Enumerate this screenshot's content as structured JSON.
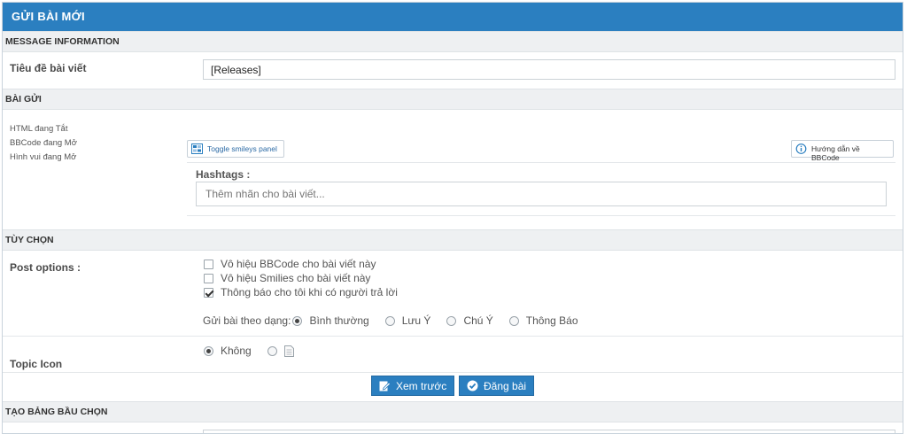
{
  "header": {
    "title": "GỬI BÀI MỚI"
  },
  "sections": {
    "message_info": "MESSAGE INFORMATION",
    "post": "BÀI GỬI",
    "options": "TÙY CHỌN",
    "poll": "TẠO BẢNG BẦU CHỌN"
  },
  "subject": {
    "label": "Tiêu đề bài viết",
    "value": "[Releases]"
  },
  "status": {
    "html": "HTML đang Tắt",
    "bbcode": "BBCode đang Mở",
    "smilies": "Hình vui đang Mở"
  },
  "editor": {
    "toggle_smileys": "Toggle smileys panel",
    "bbcode_help": "Hướng dẫn về BBCode"
  },
  "hashtags": {
    "label": "Hashtags :",
    "placeholder": "Thêm nhãn cho bài viết..."
  },
  "post_options": {
    "label": "Post options :",
    "checks": [
      {
        "text": "Vô hiệu BBCode cho bài viết này",
        "checked": false
      },
      {
        "text": "Vô hiệu Smilies cho bài viết này",
        "checked": false
      },
      {
        "text": "Thông báo cho tôi khi có người trả lời",
        "checked": true
      }
    ],
    "post_as_label": "Gửi bài theo dạng:",
    "post_as": [
      {
        "text": "Bình thường",
        "selected": true
      },
      {
        "text": "Lưu Ý",
        "selected": false
      },
      {
        "text": "Chú Ý",
        "selected": false
      },
      {
        "text": "Thông Báo",
        "selected": false
      }
    ]
  },
  "topic_icon": {
    "label": "Topic Icon",
    "none": "Không"
  },
  "buttons": {
    "preview": "Xem trước",
    "submit": "Đăng bài"
  },
  "colors": {
    "primary": "#2b7fc0",
    "section_bg": "#eef0f2"
  }
}
